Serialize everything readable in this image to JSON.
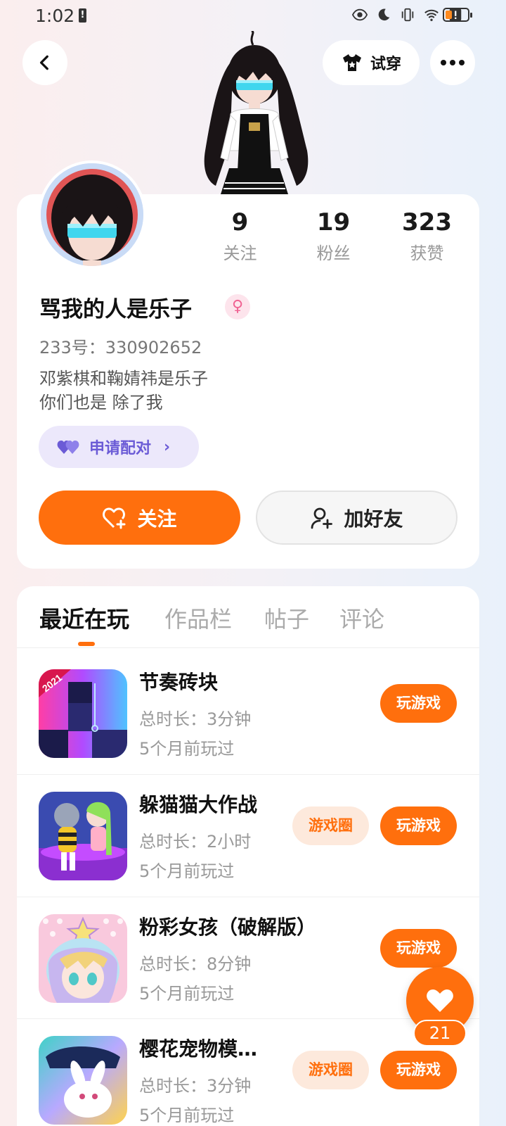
{
  "status_bar": {
    "time": "1:02",
    "alert_glyph": "!",
    "icons": [
      "eye-icon",
      "moon-icon",
      "vibrate-icon",
      "wifi-icon",
      "alert-icon",
      "battery-icon"
    ]
  },
  "header": {
    "tryon_label": "试穿"
  },
  "profile": {
    "stats": [
      {
        "value": "9",
        "label": "关注"
      },
      {
        "value": "19",
        "label": "粉丝"
      },
      {
        "value": "323",
        "label": "获赞"
      }
    ],
    "username": "骂我的人是乐子",
    "gender_symbol": "♀",
    "uid": "233号：330902652",
    "bio_line1": "邓紫棋和鞠婧祎是乐子",
    "bio_line2": "你们也是 除了我",
    "pair_label": "申请配对",
    "pair_chevron": "›",
    "follow_label": "关注",
    "add_friend_label": "加好友"
  },
  "tabs": [
    {
      "label": "最近在玩",
      "active": true
    },
    {
      "label": "作品栏",
      "active": false
    },
    {
      "label": "帖子",
      "active": false
    },
    {
      "label": "评论",
      "active": false
    }
  ],
  "games": [
    {
      "name": "节奏砖块",
      "duration": "总时长：3分钟",
      "last_played": "5个月前玩过",
      "play_label": "玩游戏",
      "circle_label": "",
      "icon_badge": "2021"
    },
    {
      "name": "躲猫猫大作战",
      "duration": "总时长：2小时",
      "last_played": "5个月前玩过",
      "play_label": "玩游戏",
      "circle_label": "游戏圈"
    },
    {
      "name": "粉彩女孩（破解版）",
      "duration": "总时长：8分钟",
      "last_played": "5个月前玩过",
      "play_label": "玩游戏",
      "circle_label": ""
    },
    {
      "name": "樱花宠物模…",
      "duration": "总时长：3分钟",
      "last_played": "5个月前玩过",
      "play_label": "玩游戏",
      "circle_label": "游戏圈"
    }
  ],
  "float_like": {
    "count": "21"
  },
  "colors": {
    "accent": "#ff6f0d",
    "pair_purple": "#6b5bd6"
  }
}
